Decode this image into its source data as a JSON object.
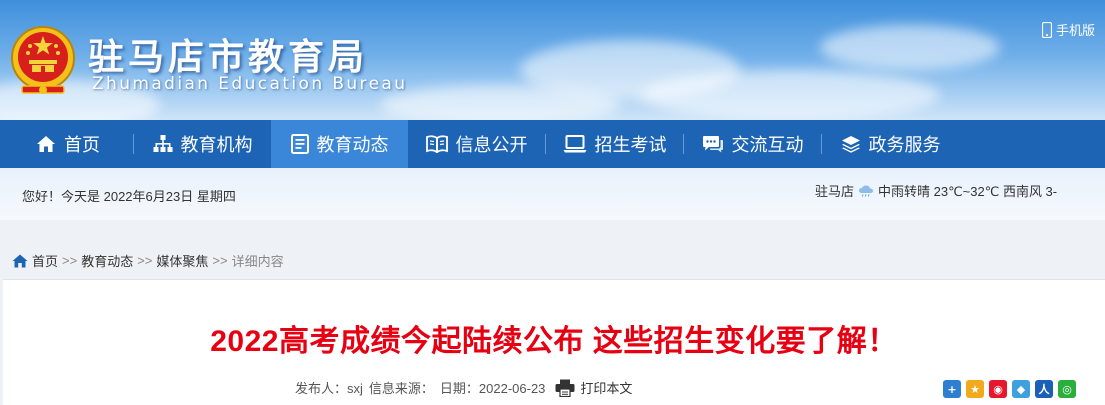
{
  "header": {
    "title": "驻马店市教育局",
    "subtitle": "Zhumadian Education Bureau",
    "mobile_label": "手机版"
  },
  "nav": {
    "items": [
      {
        "label": "首页",
        "icon": "home-icon",
        "active": false
      },
      {
        "label": "教育机构",
        "icon": "org-chart-icon",
        "active": false
      },
      {
        "label": "教育动态",
        "icon": "document-icon",
        "active": true
      },
      {
        "label": "信息公开",
        "icon": "book-icon",
        "active": false
      },
      {
        "label": "招生考试",
        "icon": "laptop-icon",
        "active": false
      },
      {
        "label": "交流互动",
        "icon": "chat-icon",
        "active": false
      },
      {
        "label": "政务服务",
        "icon": "layers-icon",
        "active": false
      }
    ]
  },
  "info": {
    "greeting": "您好！今天是 2022年6月23日 星期四",
    "weather_city": "驻马店",
    "weather_text": "中雨转晴 23℃~32℃ 西南风 3-"
  },
  "breadcrumb": {
    "items": [
      "首页",
      "教育动态",
      "媒体聚焦",
      "详细内容"
    ],
    "separator": ">>"
  },
  "article": {
    "title": "2022高考成绩今起陆续公布 这些招生变化要了解！",
    "publisher_label": "发布人：sxj",
    "source_label": "信息来源：",
    "date_label": "日期：2022-06-23",
    "print_label": "打印本文"
  },
  "share": {
    "items": [
      {
        "icon": "share-plus-icon",
        "glyph": "+",
        "color": "#2f7fd0"
      },
      {
        "icon": "qzone-icon",
        "glyph": "★",
        "color": "#f2a91b"
      },
      {
        "icon": "weibo-icon",
        "glyph": "◉",
        "color": "#e6162d"
      },
      {
        "icon": "tencent-weibo-icon",
        "glyph": "◆",
        "color": "#3fa0e0"
      },
      {
        "icon": "renren-icon",
        "glyph": "人",
        "color": "#1c5fb8"
      },
      {
        "icon": "wechat-icon",
        "glyph": "◎",
        "color": "#2aae3c"
      }
    ]
  },
  "colors": {
    "nav_bg": "#1e64b4",
    "nav_active": "#3a86d8",
    "headline": "#e60012"
  }
}
